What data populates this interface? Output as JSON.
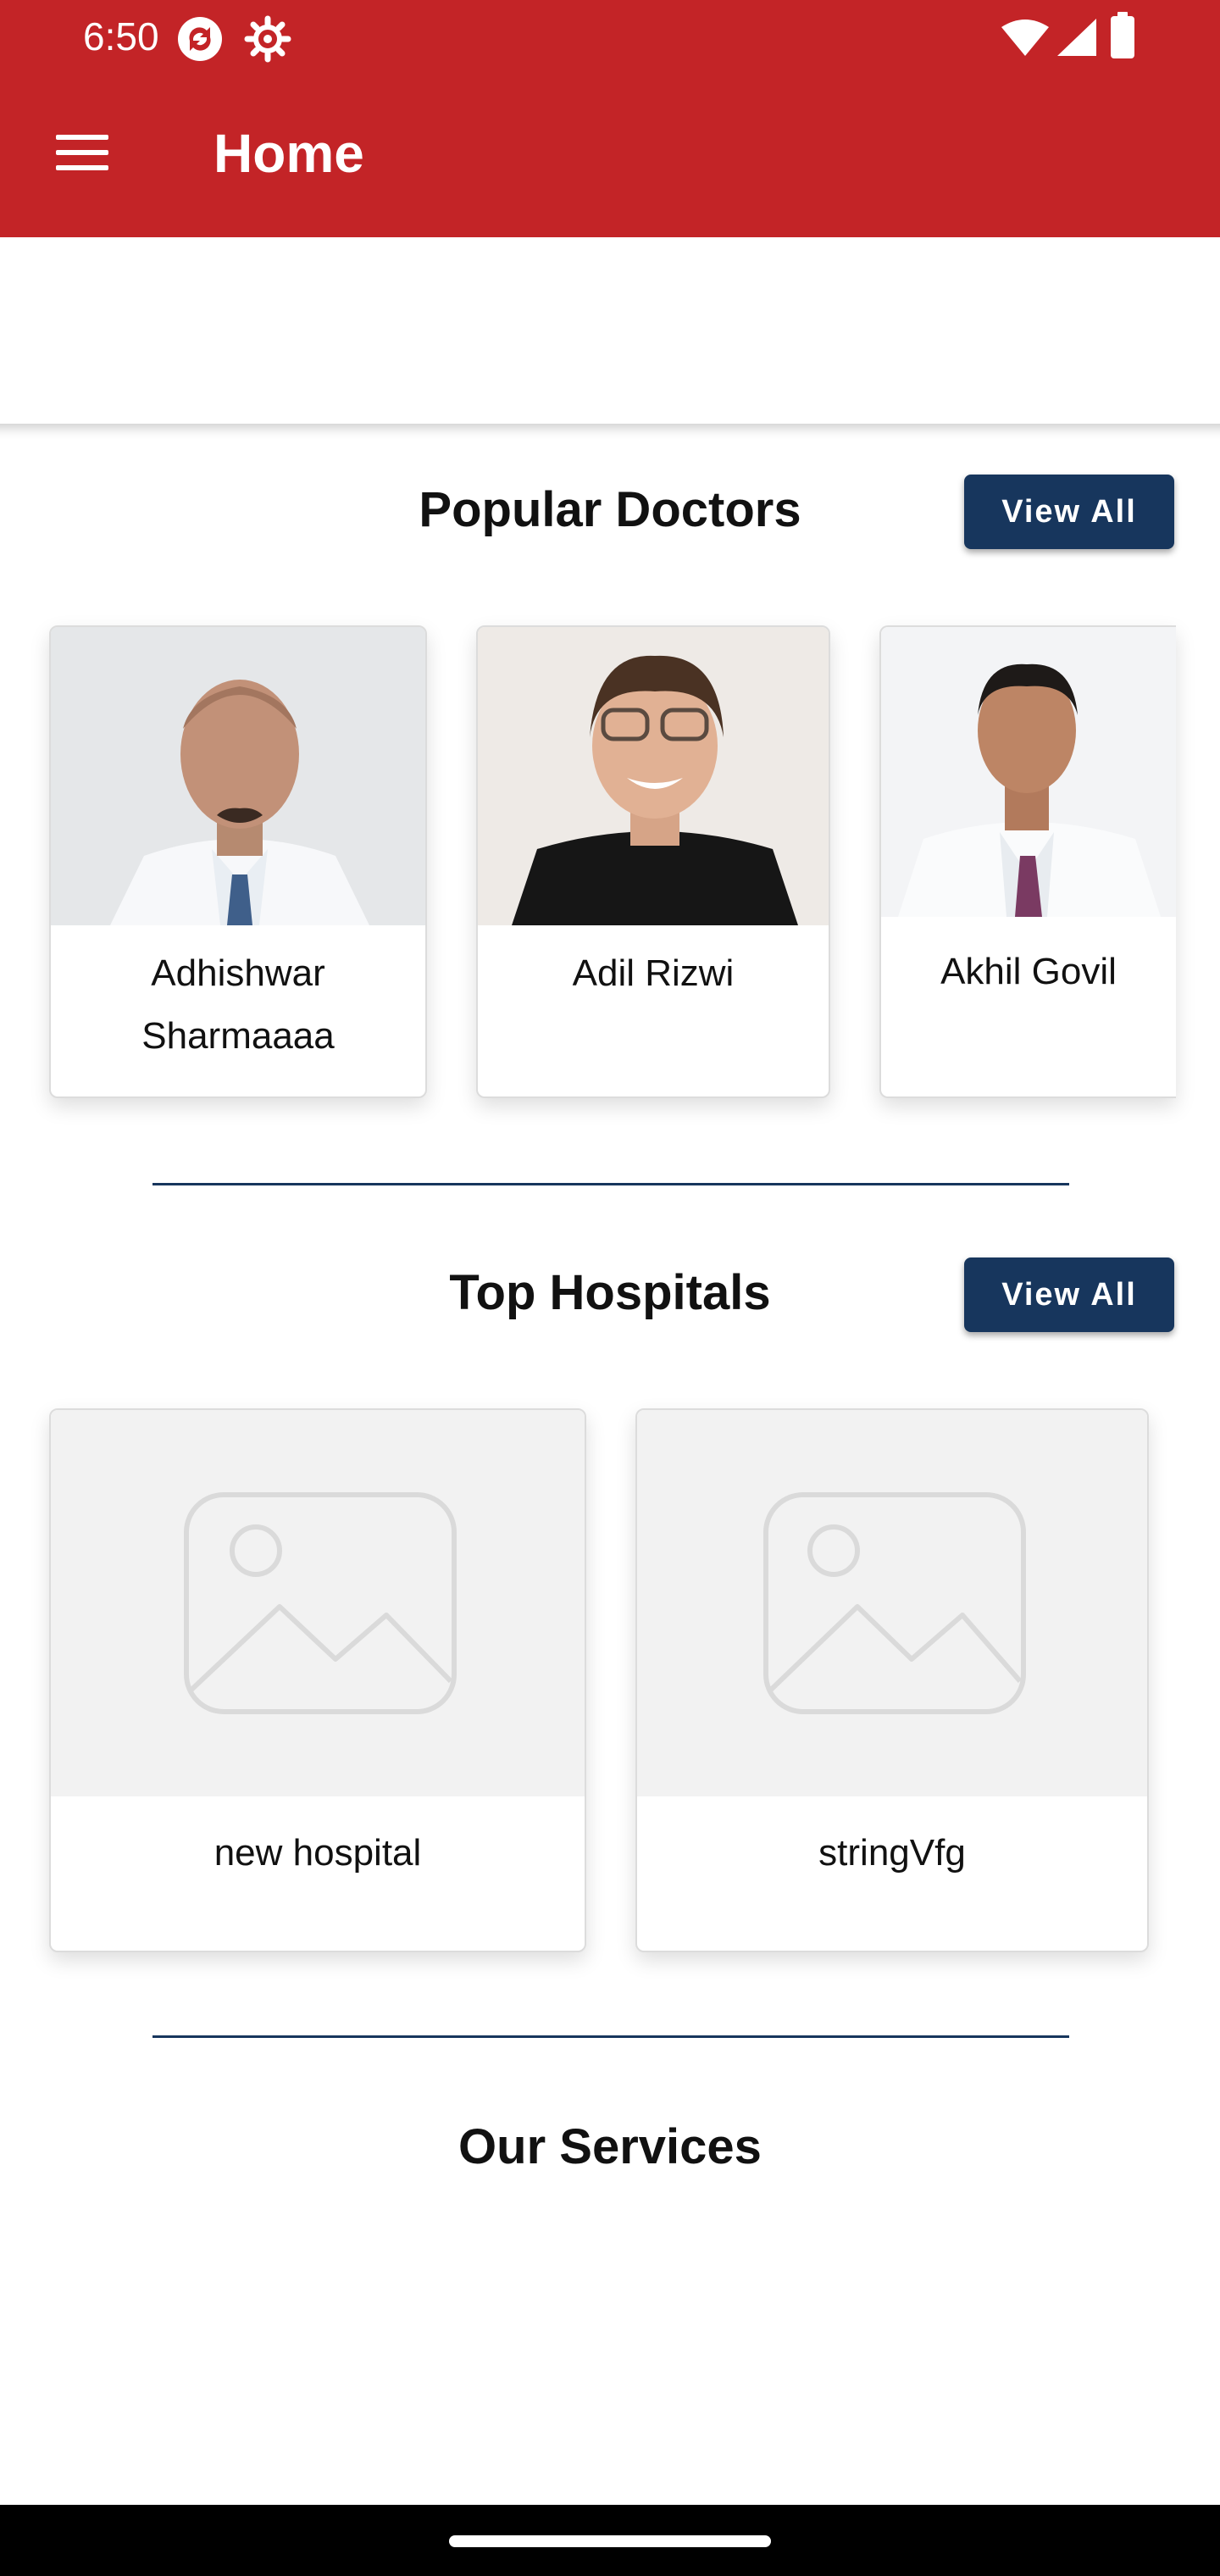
{
  "status_bar": {
    "time": "6:50",
    "icons": [
      "sync-notification-icon",
      "settings-notification-icon",
      "wifi-icon",
      "signal-icon",
      "battery-icon"
    ]
  },
  "app_bar": {
    "title": "Home",
    "menu_icon": "hamburger-menu-icon",
    "background": "#c32427"
  },
  "popular_doctors": {
    "title": "Popular Doctors",
    "view_all_label": "View All",
    "doctors": [
      {
        "name": "Adhishwar Sharmaaaa"
      },
      {
        "name": "Adil Rizwi"
      },
      {
        "name": "Akhil Govil"
      }
    ]
  },
  "top_hospitals": {
    "title": "Top Hospitals",
    "view_all_label": "View All",
    "hospitals": [
      {
        "name": "new hospital",
        "image": "image-placeholder-icon"
      },
      {
        "name": "stringVfg",
        "image": "image-placeholder-icon"
      }
    ]
  },
  "our_services": {
    "title": "Our Services"
  },
  "colors": {
    "primary": "#c32427",
    "accent": "#17365d"
  }
}
